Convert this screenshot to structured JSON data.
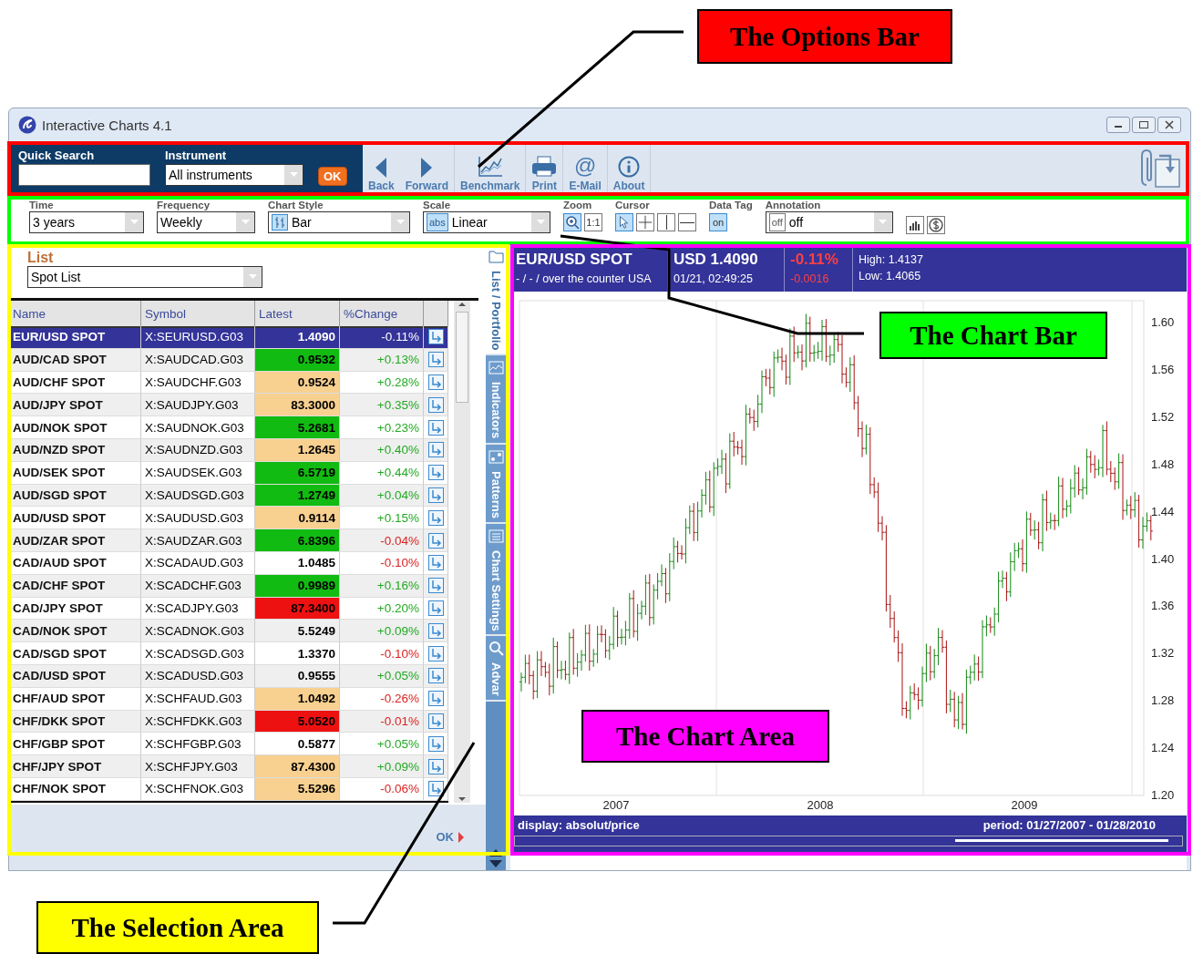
{
  "window": {
    "title": "Interactive Charts 4.1"
  },
  "options_bar": {
    "quick_search": {
      "label": "Quick Search"
    },
    "instrument": {
      "label": "Instrument",
      "value": "All instruments"
    },
    "ok_button": "OK",
    "buttons": [
      {
        "label": "Back",
        "kind": "back"
      },
      {
        "label": "Forward",
        "kind": "forward"
      },
      {
        "label": "Benchmark",
        "kind": "benchmark"
      },
      {
        "label": "Print",
        "kind": "print"
      },
      {
        "label": "E-Mail",
        "kind": "email",
        "glyph": "@"
      },
      {
        "label": "About",
        "kind": "about"
      }
    ]
  },
  "chart_bar": {
    "time": {
      "label": "Time",
      "value": "3 years"
    },
    "frequency": {
      "label": "Frequency",
      "value": "Weekly"
    },
    "chart_style": {
      "label": "Chart Style",
      "value": "Bar"
    },
    "scale": {
      "label": "Scale",
      "badge": "abs",
      "value": "Linear"
    },
    "zoom": {
      "label": "Zoom",
      "ratio": "1:1"
    },
    "cursor": {
      "label": "Cursor",
      "tools": [
        {
          "kind": "pointer",
          "selected": true
        },
        {
          "kind": "crosshair",
          "selected": false
        },
        {
          "kind": "vertical",
          "selected": false
        },
        {
          "kind": "horizontal",
          "selected": false
        }
      ]
    },
    "data_tag": {
      "label": "Data Tag",
      "value": "on"
    },
    "annotation": {
      "label": "Annotation",
      "badge": "off",
      "value": "off"
    }
  },
  "selection": {
    "list_label": "List",
    "list_value": "Spot List",
    "columns": [
      "Name",
      "Symbol",
      "Latest",
      "%Change"
    ],
    "rows": [
      {
        "name": "EUR/USD SPOT",
        "symbol": "X:SEURUSD.G03",
        "latest": "1.4090",
        "change": "-0.11%",
        "selected": true
      },
      {
        "name": "AUD/CAD SPOT",
        "symbol": "X:SAUDCAD.G03",
        "latest": "0.9532",
        "change": "+0.13%",
        "rising": true,
        "selected": false,
        "color": "#11bb11"
      },
      {
        "name": "AUD/CHF SPOT",
        "symbol": "X:SAUDCHF.G03",
        "latest": "0.9524",
        "change": "+0.28%",
        "rising": true,
        "selected": false,
        "color": "#f8d090"
      },
      {
        "name": "AUD/JPY SPOT",
        "symbol": "X:SAUDJPY.G03",
        "latest": "83.3000",
        "change": "+0.35%",
        "rising": true,
        "selected": false,
        "color": "#f8d090"
      },
      {
        "name": "AUD/NOK SPOT",
        "symbol": "X:SAUDNOK.G03",
        "latest": "5.2681",
        "change": "+0.23%",
        "rising": true,
        "selected": false,
        "color": "#11bb11"
      },
      {
        "name": "AUD/NZD SPOT",
        "symbol": "X:SAUDNZD.G03",
        "latest": "1.2645",
        "change": "+0.40%",
        "rising": true,
        "selected": false,
        "color": "#f8d090"
      },
      {
        "name": "AUD/SEK SPOT",
        "symbol": "X:SAUDSEK.G03",
        "latest": "6.5719",
        "change": "+0.44%",
        "rising": true,
        "selected": false,
        "color": "#11bb11"
      },
      {
        "name": "AUD/SGD SPOT",
        "symbol": "X:SAUDSGD.G03",
        "latest": "1.2749",
        "change": "+0.04%",
        "rising": true,
        "selected": false,
        "color": "#11bb11"
      },
      {
        "name": "AUD/USD SPOT",
        "symbol": "X:SAUDUSD.G03",
        "latest": "0.9114",
        "change": "+0.15%",
        "rising": true,
        "selected": false,
        "color": "#f8d090"
      },
      {
        "name": "AUD/ZAR SPOT",
        "symbol": "X:SAUDZAR.G03",
        "latest": "6.8396",
        "change": "-0.04%",
        "rising": false,
        "selected": false,
        "color": "#11bb11"
      },
      {
        "name": "CAD/AUD SPOT",
        "symbol": "X:SCADAUD.G03",
        "latest": "1.0485",
        "change": "-0.10%",
        "rising": false,
        "selected": false
      },
      {
        "name": "CAD/CHF SPOT",
        "symbol": "X:SCADCHF.G03",
        "latest": "0.9989",
        "change": "+0.16%",
        "rising": true,
        "selected": false,
        "color": "#11bb11"
      },
      {
        "name": "CAD/JPY SPOT",
        "symbol": "X:SCADJPY.G03",
        "latest": "87.3400",
        "change": "+0.20%",
        "rising": true,
        "selected": false,
        "color": "#ee1111"
      },
      {
        "name": "CAD/NOK SPOT",
        "symbol": "X:SCADNOK.G03",
        "latest": "5.5249",
        "change": "+0.09%",
        "rising": true,
        "selected": false
      },
      {
        "name": "CAD/SGD SPOT",
        "symbol": "X:SCADSGD.G03",
        "latest": "1.3370",
        "change": "-0.10%",
        "rising": false,
        "selected": false
      },
      {
        "name": "CAD/USD SPOT",
        "symbol": "X:SCADUSD.G03",
        "latest": "0.9555",
        "change": "+0.05%",
        "rising": true,
        "selected": false
      },
      {
        "name": "CHF/AUD SPOT",
        "symbol": "X:SCHFAUD.G03",
        "latest": "1.0492",
        "change": "-0.26%",
        "rising": false,
        "selected": false,
        "color": "#f8d090"
      },
      {
        "name": "CHF/DKK SPOT",
        "symbol": "X:SCHFDKK.G03",
        "latest": "5.0520",
        "change": "-0.01%",
        "rising": false,
        "selected": false,
        "color": "#ee1111"
      },
      {
        "name": "CHF/GBP SPOT",
        "symbol": "X:SCHFGBP.G03",
        "latest": "0.5877",
        "change": "+0.05%",
        "rising": true,
        "selected": false
      },
      {
        "name": "CHF/JPY SPOT",
        "symbol": "X:SCHFJPY.G03",
        "latest": "87.4300",
        "change": "+0.09%",
        "rising": true,
        "selected": false,
        "color": "#f8d090"
      },
      {
        "name": "CHF/NOK SPOT",
        "symbol": "X:SCHFNOK.G03",
        "latest": "5.5296",
        "change": "-0.06%",
        "rising": false,
        "selected": false,
        "color": "#f8d090"
      }
    ],
    "ok_label": "OK",
    "side_tabs": [
      {
        "label": "List / Portfolio",
        "kind": "folder",
        "selected": true
      },
      {
        "label": "Indicators",
        "kind": "indicators",
        "selected": false
      },
      {
        "label": "Patterns",
        "kind": "patterns",
        "selected": false
      },
      {
        "label": "Chart Settings",
        "kind": "settings",
        "selected": false
      },
      {
        "label": "Advar",
        "kind": "search",
        "selected": false
      }
    ]
  },
  "chart": {
    "header": {
      "name": "EUR/USD SPOT",
      "subtitle": "- / - / over the counter USA",
      "price": "USD 1.4090",
      "time": "01/21, 02:49:25",
      "change_pct": "-0.11%",
      "change_abs": "-0.0016",
      "high": "High: 1.4137",
      "low": "Low: 1.4065"
    },
    "y_labels": [
      "1.60",
      "1.56",
      "1.52",
      "1.48",
      "1.44",
      "1.40",
      "1.36",
      "1.32",
      "1.28",
      "1.24",
      "1.20"
    ],
    "x_labels": [
      "2007",
      "2008",
      "2009"
    ],
    "display": "display: absolut/price",
    "period": "period: 01/27/2007 - 01/28/2010"
  },
  "callouts": [
    {
      "text": "The Options Bar",
      "color": "#ff0000"
    },
    {
      "text": "The Chart Bar",
      "color": "#00ff00"
    },
    {
      "text": "The Chart Area",
      "color": "#ff00ff"
    },
    {
      "text": "The Selection Area",
      "color": "#ffff00"
    }
  ]
}
